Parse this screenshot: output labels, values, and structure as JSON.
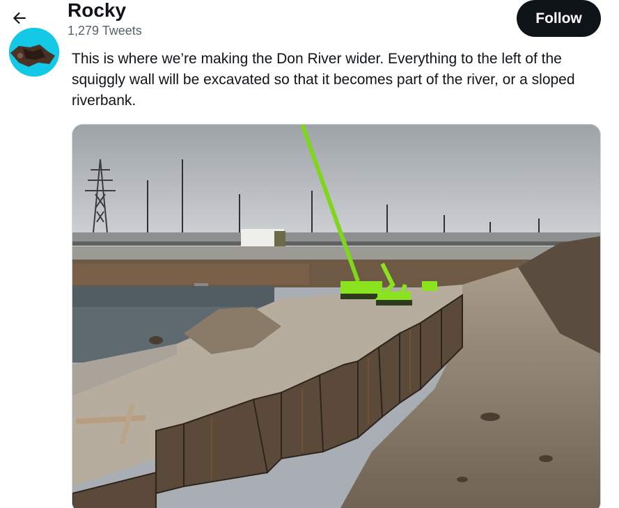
{
  "header": {
    "back_icon": "arrow-left-icon",
    "name": "Rocky",
    "tweet_count": "1,279 Tweets",
    "follow_label": "Follow"
  },
  "tweet": {
    "text": "This is where we’re making the Don River wider. Everything to the left of the squiggly wall will be excavated so that it becomes part of the river, or a sloped riverbank.",
    "media_description_icon": "photo-icon"
  },
  "colors": {
    "follow_bg": "#0f1419",
    "avatar_bg": "#14c9e6",
    "excavator": "#8be31f",
    "sky": "#c9cdd1"
  }
}
